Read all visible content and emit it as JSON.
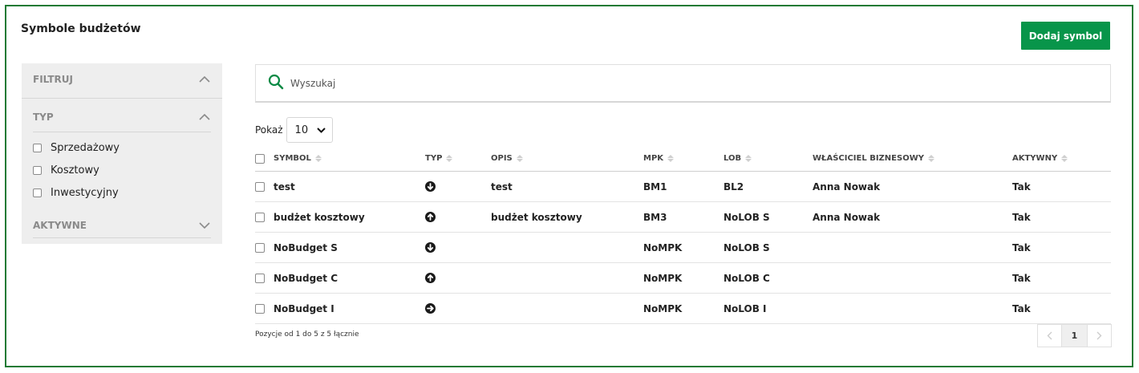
{
  "page": {
    "title": "Symbole budżetów",
    "add_button": "Dodaj symbol"
  },
  "filter": {
    "title": "FILTRUJ",
    "type_section": "TYP",
    "type_options": [
      "Sprzedażowy",
      "Kosztowy",
      "Inwestycyjny"
    ],
    "active_section": "AKTYWNE"
  },
  "search": {
    "placeholder": "Wyszukaj",
    "value": ""
  },
  "page_size": {
    "label": "Pokaż",
    "value": "10"
  },
  "table": {
    "columns": [
      "SYMBOL",
      "TYP",
      "OPIS",
      "MPK",
      "LOB",
      "WŁAŚCICIEL BIZNESOWY",
      "AKTYWNY"
    ],
    "rows": [
      {
        "symbol": "test",
        "type_icon": "arrow-down-circle-icon",
        "opis": "test",
        "mpk": "BM1",
        "lob": "BL2",
        "owner": "Anna Nowak",
        "active": "Tak"
      },
      {
        "symbol": "budżet kosztowy",
        "type_icon": "arrow-up-circle-icon",
        "opis": "budżet kosztowy",
        "mpk": "BM3",
        "lob": "NoLOB S",
        "owner": "Anna Nowak",
        "active": "Tak"
      },
      {
        "symbol": "NoBudget S",
        "type_icon": "arrow-down-circle-icon",
        "opis": "",
        "mpk": "NoMPK",
        "lob": "NoLOB S",
        "owner": "",
        "active": "Tak"
      },
      {
        "symbol": "NoBudget C",
        "type_icon": "arrow-up-circle-icon",
        "opis": "",
        "mpk": "NoMPK",
        "lob": "NoLOB C",
        "owner": "",
        "active": "Tak"
      },
      {
        "symbol": "NoBudget I",
        "type_icon": "arrow-right-circle-icon",
        "opis": "",
        "mpk": "NoMPK",
        "lob": "NoLOB I",
        "owner": "",
        "active": "Tak"
      }
    ]
  },
  "footer": {
    "info": "Pozycje od 1 do 5 z 5 łącznie",
    "pages": [
      "1"
    ]
  },
  "colors": {
    "brand": "#08954a",
    "frame": "#1e7a34",
    "search_icon": "#0a8a45"
  }
}
